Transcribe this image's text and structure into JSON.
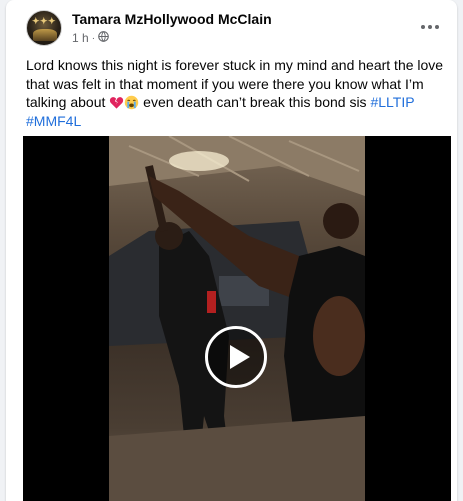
{
  "post": {
    "author_name": "Tamara MzHollywood McClain",
    "timestamp": "1 h",
    "separator": "·",
    "audience_icon": "globe-icon",
    "more_icon": "more-horizontal-icon",
    "text_part1": "Lord knows this night is forever stuck in my mind and heart the love that was felt in that moment if you were there you know what I’m talking about ",
    "text_part2": " even death can’t break this bond sis ",
    "emojis": [
      "broken-heart-emoji",
      "loudly-crying-face-emoji"
    ],
    "hashtags": [
      "#LLTIP",
      "#MMF4L"
    ],
    "video": {
      "play_icon": "play-icon"
    }
  }
}
